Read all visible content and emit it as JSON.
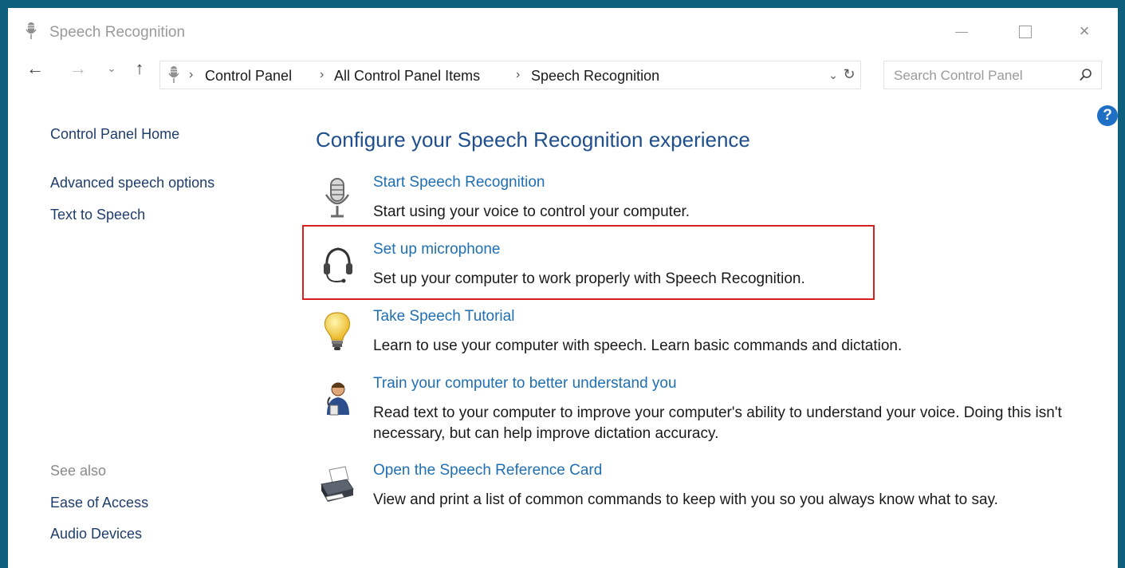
{
  "window": {
    "title": "Speech Recognition",
    "controls": {
      "minimize": "minimize",
      "maximize": "maximize",
      "close": "×"
    }
  },
  "navigation": {
    "back_icon": "←",
    "forward_icon": "→",
    "recent_icon": "⌄",
    "up_icon": "↑"
  },
  "address_bar": {
    "crumbs": [
      "Control Panel",
      "All Control Panel Items",
      "Speech Recognition"
    ],
    "separator": "›",
    "dropdown_icon": "⌄",
    "refresh_icon": "↻"
  },
  "search": {
    "placeholder": "Search Control Panel"
  },
  "help": {
    "label": "?"
  },
  "sidebar": {
    "home": "Control Panel Home",
    "links": [
      "Advanced speech options",
      "Text to Speech"
    ],
    "see_also_heading": "See also",
    "see_also_links": [
      "Ease of Access",
      "Audio Devices"
    ]
  },
  "main": {
    "title": "Configure your Speech Recognition experience",
    "tasks": [
      {
        "icon": "microphone-icon",
        "link": "Start Speech Recognition",
        "description": "Start using your voice to control your computer."
      },
      {
        "icon": "headset-icon",
        "link": "Set up microphone",
        "description": "Set up your computer to work properly with Speech Recognition.",
        "highlighted": true
      },
      {
        "icon": "lightbulb-icon",
        "link": "Take Speech Tutorial",
        "description": "Learn to use your computer with speech.  Learn basic commands and dictation."
      },
      {
        "icon": "user-train-icon",
        "link": "Train your computer to better understand you",
        "description": "Read text to your computer to improve your computer's ability to understand your voice.  Doing this isn't necessary, but can help improve dictation accuracy."
      },
      {
        "icon": "printer-icon",
        "link": "Open the Speech Reference Card",
        "description": "View and print a list of common commands to keep with you so you always know what to say."
      }
    ]
  },
  "colors": {
    "frame": "#0e5e7e",
    "link": "#1f6fb3",
    "title": "#1e4e8c",
    "highlight_border": "#d92020"
  }
}
